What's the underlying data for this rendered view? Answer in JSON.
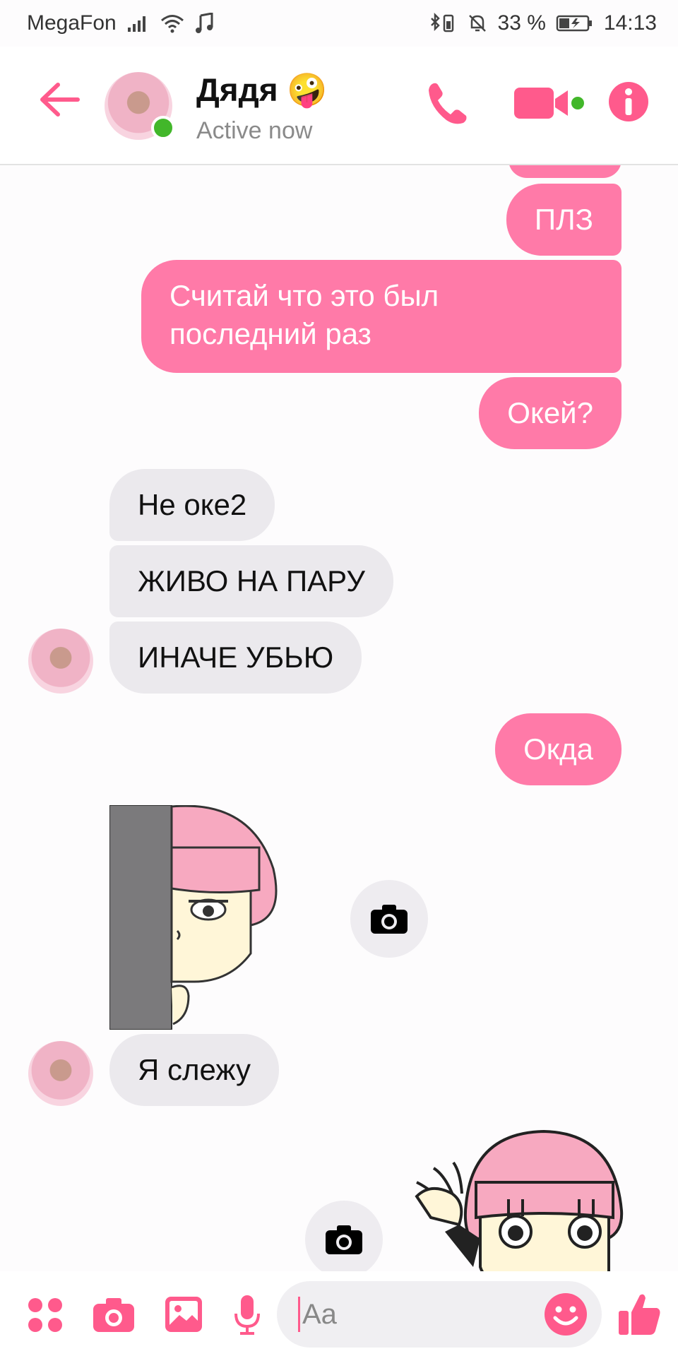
{
  "status_bar": {
    "carrier": "MegaFon",
    "battery": "33 %",
    "time": "14:13"
  },
  "header": {
    "back_icon": "arrow-left-icon",
    "name": "Дядя 🤪",
    "status": "Active now",
    "call_icon": "phone-icon",
    "video_icon": "video-camera-icon",
    "info_icon": "info-icon"
  },
  "messages": [
    {
      "text": "ПЛЗ",
      "from": "me"
    },
    {
      "line1": "Считай что это был",
      "line2": "последний раз",
      "from": "me"
    },
    {
      "text": "Окей?",
      "from": "me"
    },
    {
      "text": "Не оке2",
      "from": "contact"
    },
    {
      "text": "ЖИВО НА ПАРУ",
      "from": "contact"
    },
    {
      "text": "ИНАЧЕ УБЬЮ",
      "from": "contact"
    },
    {
      "text": "Окда",
      "from": "me"
    },
    {
      "sticker": "peeking-girl-sticker",
      "from": "contact"
    },
    {
      "text": "Я слежу",
      "from": "contact"
    },
    {
      "sticker": "waving-girl-sticker",
      "from": "me"
    }
  ],
  "composer": {
    "placeholder": "Aa"
  },
  "colors": {
    "accent": "#ff5a8c",
    "outgoing_bubble": "#ff7aa8",
    "incoming_bubble": "#ebe9ed",
    "online": "#42b72a"
  }
}
